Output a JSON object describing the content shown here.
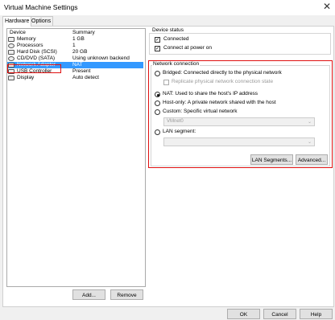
{
  "window": {
    "title": "Virtual Machine Settings"
  },
  "tabs": [
    {
      "label": "Hardware"
    },
    {
      "label": "Options"
    }
  ],
  "device_list": {
    "header": {
      "device": "Device",
      "summary": "Summary"
    },
    "items": [
      {
        "name": "Memory",
        "summary": "1 GB",
        "icon": "memory-icon"
      },
      {
        "name": "Processors",
        "summary": "1",
        "icon": "processor-icon"
      },
      {
        "name": "Hard Disk (SCSI)",
        "summary": "20 GB",
        "icon": "hard-disk-icon"
      },
      {
        "name": "CD/DVD (SATA)",
        "summary": "Using unknown backend",
        "icon": "cd-dvd-icon"
      },
      {
        "name": "Network Adapter",
        "summary": "NAT",
        "icon": "network-adapter-icon",
        "selected": true
      },
      {
        "name": "USB Controller",
        "summary": "Present",
        "icon": "usb-icon"
      },
      {
        "name": "Display",
        "summary": "Auto detect",
        "icon": "display-icon"
      }
    ]
  },
  "buttons": {
    "add": "Add...",
    "remove": "Remove",
    "ok": "OK",
    "cancel": "Cancel",
    "help": "Help",
    "lan_segments": "LAN Segments...",
    "advanced": "Advanced..."
  },
  "device_status": {
    "title": "Device status",
    "connected": {
      "label": "Connected",
      "checked": true
    },
    "connect_at_power_on": {
      "label": "Connect at power on",
      "checked": true
    }
  },
  "network_connection": {
    "title": "Network connection",
    "bridged": "Bridged: Connected directly to the physical network",
    "replicate": "Replicate physical network connection state",
    "nat": "NAT: Used to share the host's IP address",
    "host_only": "Host-only: A private network shared with the host",
    "custom": "Custom: Specific virtual network",
    "custom_value": "VMnet0",
    "lan_segment": "LAN segment:",
    "selected": "nat"
  },
  "colors": {
    "highlight": "#e01010",
    "selection": "#3399ff"
  }
}
